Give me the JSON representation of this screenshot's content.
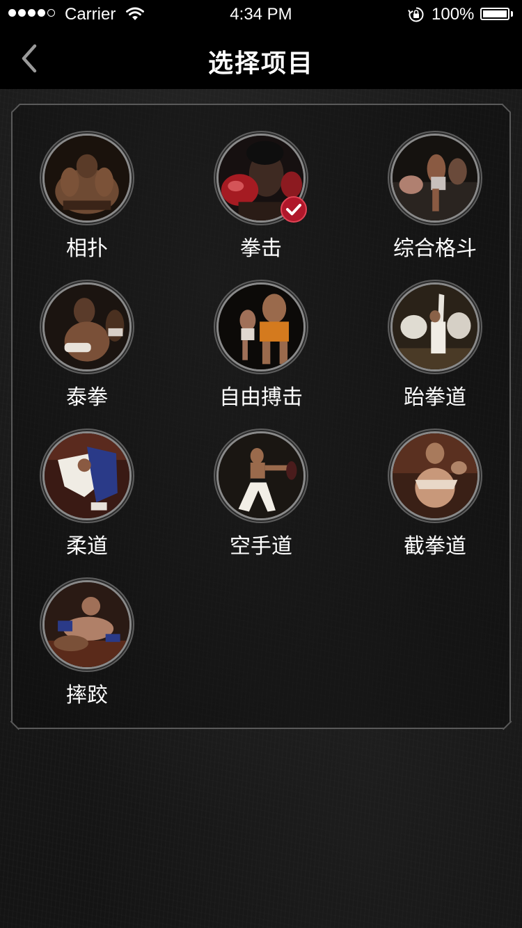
{
  "status_bar": {
    "carrier": "Carrier",
    "time": "4:34 PM",
    "battery": "100%"
  },
  "nav": {
    "title": "选择项目"
  },
  "sports": [
    {
      "label": "相扑",
      "selected": false,
      "icon": "sumo-photo"
    },
    {
      "label": "拳击",
      "selected": true,
      "icon": "boxing-photo"
    },
    {
      "label": "综合格斗",
      "selected": false,
      "icon": "mma-photo"
    },
    {
      "label": "泰拳",
      "selected": false,
      "icon": "muay-thai-photo"
    },
    {
      "label": "自由搏击",
      "selected": false,
      "icon": "kickboxing-photo"
    },
    {
      "label": "跆拳道",
      "selected": false,
      "icon": "taekwondo-photo"
    },
    {
      "label": "柔道",
      "selected": false,
      "icon": "judo-photo"
    },
    {
      "label": "空手道",
      "selected": false,
      "icon": "karate-photo"
    },
    {
      "label": "截拳道",
      "selected": false,
      "icon": "jeet-kune-do-photo"
    },
    {
      "label": "摔跤",
      "selected": false,
      "icon": "wrestling-photo"
    }
  ],
  "colors": {
    "selected_badge": "#b0172a",
    "border": "#5a5a5a"
  }
}
